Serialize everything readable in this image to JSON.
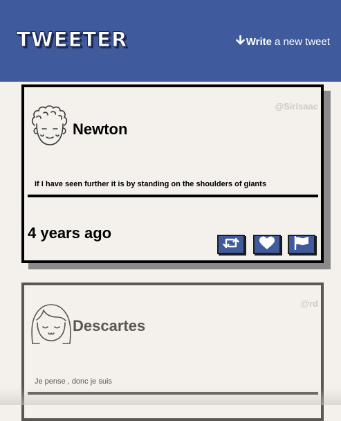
{
  "header": {
    "logo_text": "TWEETER",
    "compose_arrow": "🡓",
    "compose_bold": "Write",
    "compose_rest": "a new tweet"
  },
  "tweets": [
    {
      "name": "Newton",
      "handle": "@SirIsaac",
      "content": "If I have seen further it is by standing on the shoulders of giants",
      "time": "4 years ago",
      "avatar_icon": "curly-hair-avatar-icon",
      "actions": [
        "retweet-icon",
        "heart-icon",
        "flag-icon"
      ]
    },
    {
      "name": "Descartes",
      "handle": "@rd",
      "content": "Je pense , donc je suis",
      "avatar_icon": "bob-hair-avatar-icon"
    }
  ],
  "colors": {
    "nav_bg": "#3f5b9e",
    "page_bg": "#f4f1ec",
    "border_active": "#000000",
    "border_muted": "#5a5650",
    "handle": "#cfcac3"
  }
}
